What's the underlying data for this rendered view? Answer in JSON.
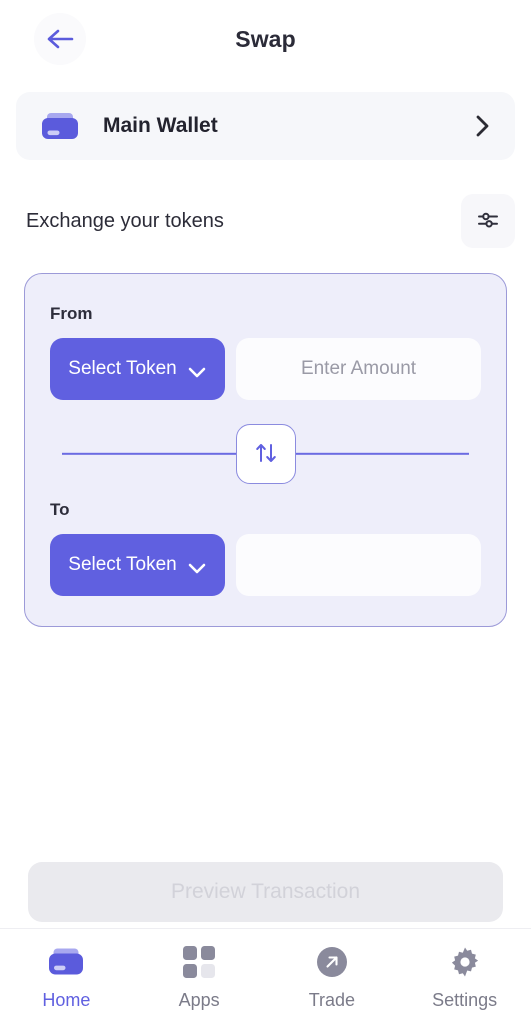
{
  "header": {
    "title": "Swap",
    "back_icon": "arrow-left-icon"
  },
  "wallet": {
    "name": "Main Wallet",
    "icon": "wallet-icon",
    "chevron_icon": "chevron-right-icon"
  },
  "section": {
    "title": "Exchange your tokens",
    "settings_icon": "tune-sliders-icon"
  },
  "swap": {
    "from": {
      "label": "From",
      "token_button_label": "Select Token",
      "token_chevron_icon": "chevron-down-icon",
      "amount_value": "",
      "amount_placeholder": "Enter Amount"
    },
    "toggle": {
      "icon": "swap-vertical-arrows-icon"
    },
    "to": {
      "label": "To",
      "token_button_label": "Select Token",
      "token_chevron_icon": "chevron-down-icon",
      "amount_value": "",
      "amount_placeholder": ""
    }
  },
  "action": {
    "preview_label": "Preview Transaction",
    "preview_disabled": true
  },
  "bottom_nav": {
    "items": [
      {
        "label": "Home",
        "icon": "wallet-icon",
        "active": true
      },
      {
        "label": "Apps",
        "icon": "grid-apps-icon",
        "active": false
      },
      {
        "label": "Trade",
        "icon": "trade-expand-arrows-icon",
        "active": false
      },
      {
        "label": "Settings",
        "icon": "gear-icon",
        "active": false
      }
    ]
  },
  "colors": {
    "primary": "#6060e0",
    "card_bg": "#eeeefa",
    "card_border": "#9c9ad8",
    "muted_text": "#7b7b89",
    "disabled_bg": "#eaeaee"
  }
}
